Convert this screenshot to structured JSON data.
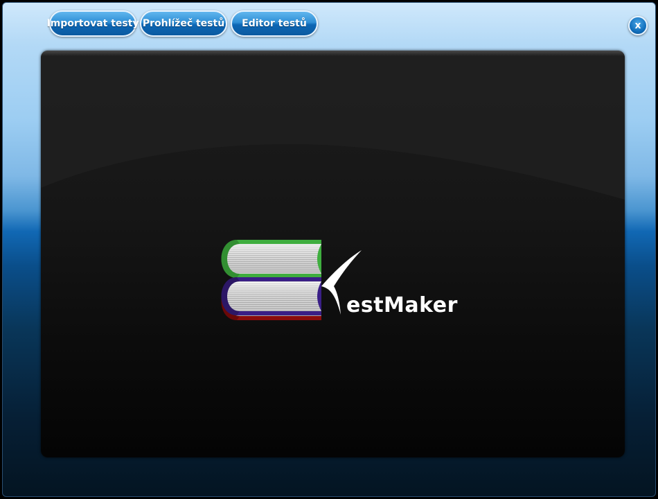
{
  "toolbar": {
    "import_label": "Importovat testy",
    "viewer_label": "Prohlížeč testů",
    "editor_label": "Editor testů"
  },
  "window": {
    "close_label": "x"
  },
  "logo": {
    "text": "estMaker",
    "book_colors": [
      "#3fae3f",
      "#8b0c0c",
      "#3a1f86"
    ]
  },
  "colors": {
    "accent": "#0d67b5",
    "panel_background": "#111111"
  }
}
